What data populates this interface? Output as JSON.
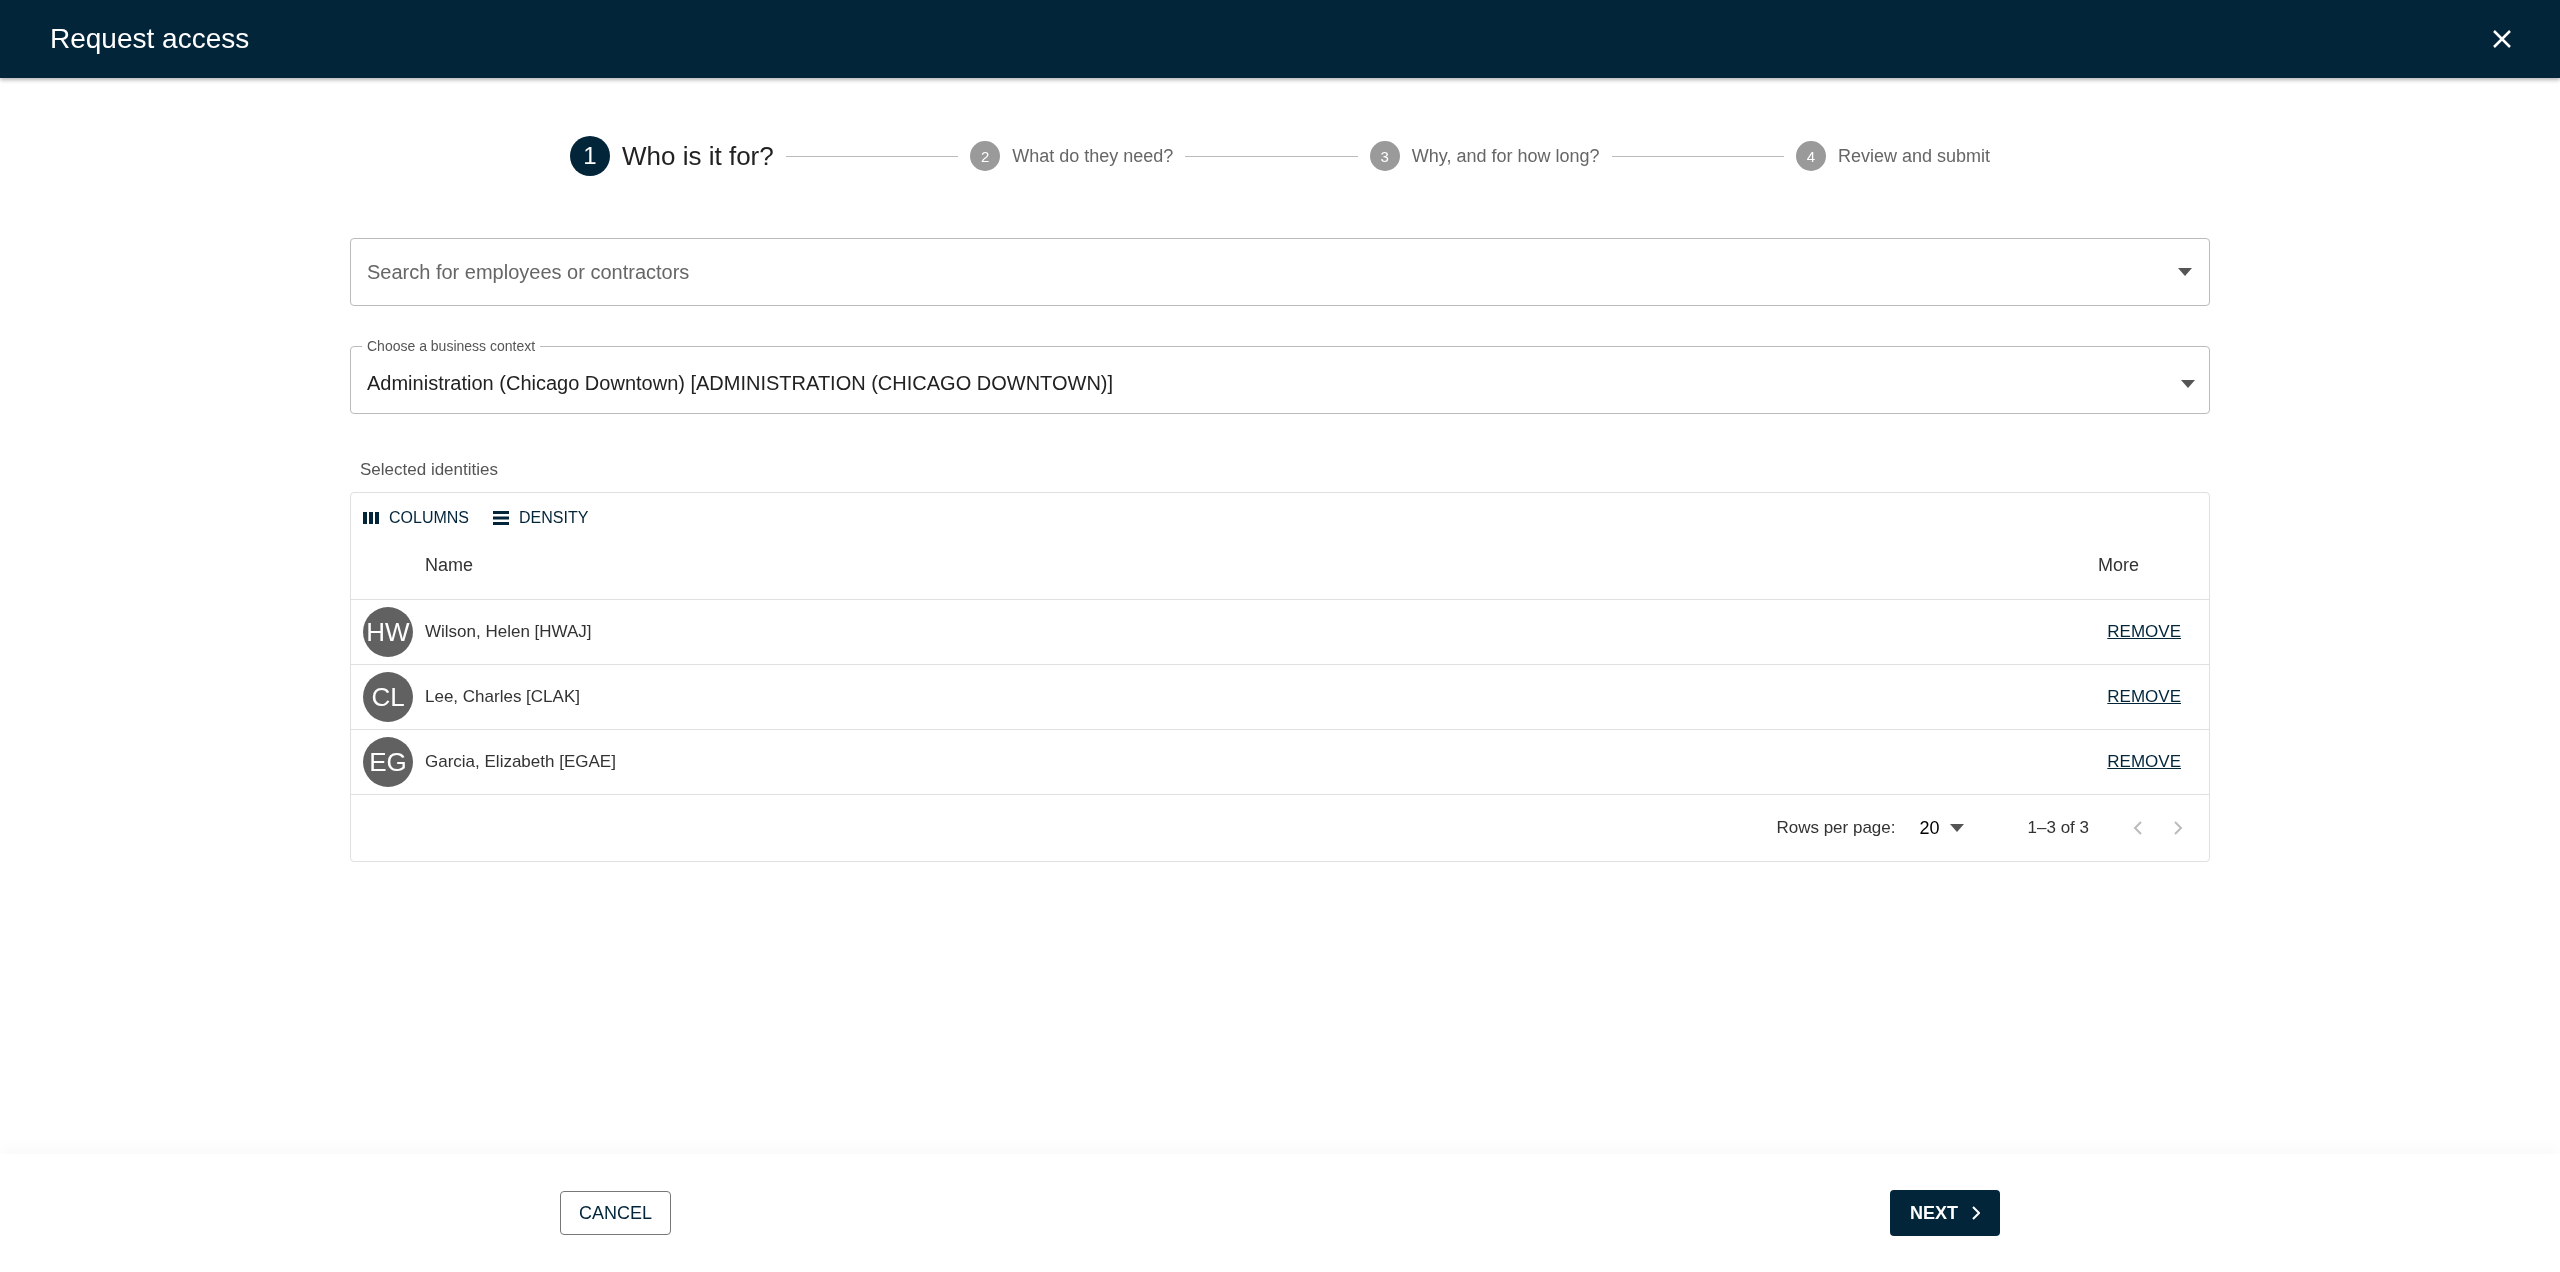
{
  "dialog": {
    "title": "Request access"
  },
  "steps": [
    {
      "number": "1",
      "label": "Who is it for?",
      "selected": true
    },
    {
      "number": "2",
      "label": "What do they need?",
      "selected": false
    },
    {
      "number": "3",
      "label": "Why, and for how long?",
      "selected": false
    },
    {
      "number": "4",
      "label": "Review and submit",
      "selected": false
    }
  ],
  "search": {
    "placeholder": "Search for employees or contractors"
  },
  "business_context": {
    "label": "Choose a business context",
    "value": "Administration (Chicago Downtown) [ADMINISTRATION (CHICAGO DOWNTOWN)]"
  },
  "identities": {
    "title": "Selected identities",
    "toolbar": [
      "COLUMNS",
      "DENSITY"
    ],
    "columns": [
      "Name",
      "More"
    ],
    "rows": [
      {
        "initials": "HW",
        "name": "Wilson, Helen [HWAJ]",
        "action": "REMOVE"
      },
      {
        "initials": "CL",
        "name": "Lee, Charles [CLAK]",
        "action": "REMOVE"
      },
      {
        "initials": "EG",
        "name": "Garcia, Elizabeth [EGAE]",
        "action": "REMOVE"
      }
    ],
    "rows_per_page_label": "Rows per page:",
    "rows_per_page": "20",
    "range": "1–3 of 3"
  },
  "buttons": {
    "cancel": "CANCEL",
    "next": "NEXT"
  }
}
